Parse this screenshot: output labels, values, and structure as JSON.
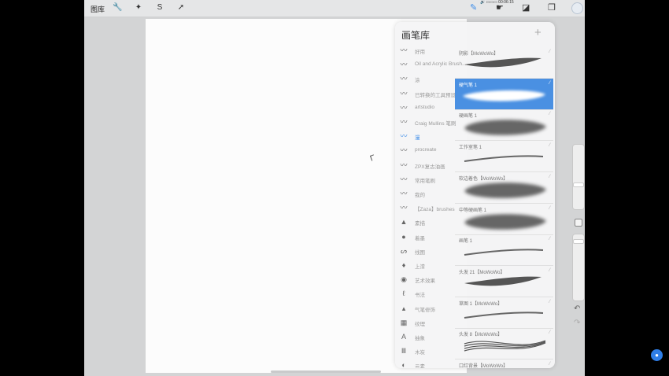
{
  "topbar": {
    "gallery_label": "图库",
    "left_tools": [
      {
        "name": "wrench-icon",
        "glyph": "🔧"
      },
      {
        "name": "magic-wand-icon",
        "glyph": "✦"
      },
      {
        "name": "selection-icon",
        "glyph": "S"
      },
      {
        "name": "transform-icon",
        "glyph": "➚"
      }
    ],
    "right_tools": [
      {
        "name": "brush-icon",
        "glyph": "✎"
      },
      {
        "name": "smudge-icon",
        "glyph": "☛"
      },
      {
        "name": "eraser-icon",
        "glyph": "◪"
      },
      {
        "name": "layers-icon",
        "glyph": "❐"
      }
    ],
    "status": "🔊 ▭▭▭ 00:06:15"
  },
  "brush_library": {
    "title": "画笔库",
    "add_glyph": "+",
    "sets": [
      {
        "label": "好用",
        "icon": "〰"
      },
      {
        "label": "Oil and Acrylic Brush...",
        "icon": "〰"
      },
      {
        "label": "涂",
        "icon": "〰"
      },
      {
        "label": "已转换的工具预设",
        "icon": "〰"
      },
      {
        "label": "artstudio",
        "icon": "〰"
      },
      {
        "label": "Craig Mullins 笔刷",
        "icon": "〰"
      },
      {
        "label": "漫",
        "icon": "〰",
        "active": true
      },
      {
        "label": "procreate",
        "icon": "〰"
      },
      {
        "label": "ZPX复古油画",
        "icon": "〰"
      },
      {
        "label": "常用笔刷",
        "icon": "〰"
      },
      {
        "label": "我的",
        "icon": "〰"
      },
      {
        "label": "【Zaza】brushes",
        "icon": "〰"
      },
      {
        "label": "素描",
        "icon": "▲"
      },
      {
        "label": "着墨",
        "icon": "●"
      },
      {
        "label": "线图",
        "icon": "ᔕ"
      },
      {
        "label": "上漆",
        "icon": "♦"
      },
      {
        "label": "艺术效果",
        "icon": "◉"
      },
      {
        "label": "书法",
        "icon": "ℓ"
      },
      {
        "label": "气笔修饰",
        "icon": "▴"
      },
      {
        "label": "纹理",
        "icon": "▦"
      },
      {
        "label": "抽象",
        "icon": "A"
      },
      {
        "label": "木炭",
        "icon": "Ⅲ"
      },
      {
        "label": "元素",
        "icon": "◐"
      }
    ],
    "brushes": [
      {
        "name": "阴影【MoWoWo】",
        "style": "taper"
      },
      {
        "name": "硬气笔 1",
        "style": "soft-white",
        "selected": true
      },
      {
        "name": "硬画笔 1",
        "style": "blob"
      },
      {
        "name": "工作室笔 1",
        "style": "thin"
      },
      {
        "name": "软边着色【MoWoWo】",
        "style": "blob"
      },
      {
        "name": "中等硬画笔 1",
        "style": "blob"
      },
      {
        "name": "画笔 1",
        "style": "thin"
      },
      {
        "name": "头发 21【MoWoWo】",
        "style": "taper"
      },
      {
        "name": "草图 1【MoWoWo】",
        "style": "thin"
      },
      {
        "name": "头发 8【MoWoWo】",
        "style": "hair"
      },
      {
        "name": "口红背景【MoWoWo】",
        "style": "thin"
      }
    ]
  },
  "colors": {
    "accent": "#4a90e2",
    "panel": "#f5f5f6",
    "canvas": "#fcfcfc"
  }
}
